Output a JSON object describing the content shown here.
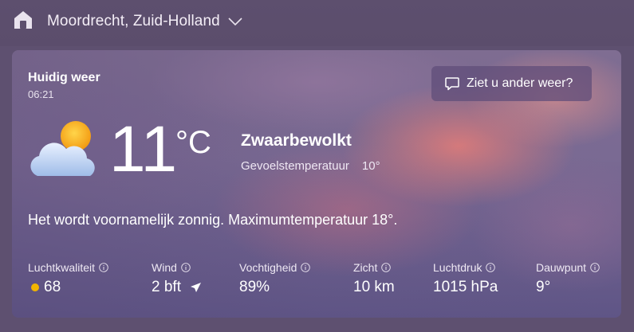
{
  "header": {
    "home_icon": "home-icon",
    "location": "Moordrecht, Zuid-Holland",
    "chevron_icon": "chevron-down-icon"
  },
  "current": {
    "label": "Huidig weer",
    "time": "06:21",
    "feedback_label": "Ziet u ander weer?",
    "feedback_icon": "chat-bubble-icon",
    "weather_icon": "partly-cloudy-sun-icon",
    "temperature": "11",
    "unit": "°C",
    "condition": "Zwaarbewolkt",
    "feels_like_label": "Gevoelstemperatuur",
    "feels_like_value": "10°",
    "summary": "Het wordt voornamelijk zonnig. Maximumtemperatuur 18°."
  },
  "metrics": [
    {
      "label": "Luchtkwaliteit",
      "value": "68",
      "indicator_color": "#f2b500"
    },
    {
      "label": "Wind",
      "value": "2 bft",
      "icon": "wind-direction-arrow-icon"
    },
    {
      "label": "Vochtigheid",
      "value": "89%"
    },
    {
      "label": "Zicht",
      "value": "10 km"
    },
    {
      "label": "Luchtdruk",
      "value": "1015 hPa"
    },
    {
      "label": "Dauwpunt",
      "value": "9°"
    }
  ]
}
